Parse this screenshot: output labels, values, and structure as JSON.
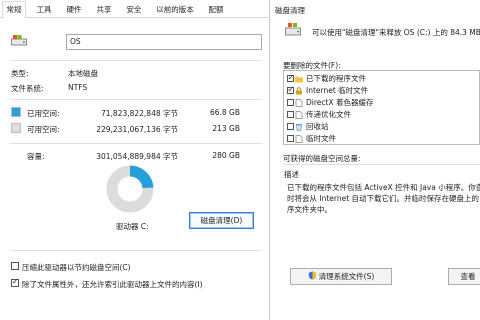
{
  "left": {
    "tabs": [
      "常规",
      "工具",
      "硬件",
      "共享",
      "安全",
      "以前的版本",
      "配额"
    ],
    "volume_name": "OS",
    "type_label": "类型:",
    "type_value": "本地磁盘",
    "fs_label": "文件系统:",
    "fs_value": "NTFS",
    "used_label": "已用空间:",
    "used_bytes": "71,823,822,848 字节",
    "used_gb": "66.8 GB",
    "free_label": "可用空间:",
    "free_bytes": "229,231,067,136 字节",
    "free_gb": "213 GB",
    "capacity_label": "容量:",
    "capacity_bytes": "301,054,889,984 字节",
    "capacity_gb": "280 GB",
    "drive_label": "驱动器 C:",
    "cleanup_button": "磁盘清理(D)",
    "compress_label": "压缩此驱动器以节约磁盘空间(C)",
    "index_label": "除了文件属性外，还允许索引此驱动器上文件的内容(I)",
    "compress_checked": false,
    "index_checked": true,
    "used_fraction": 0.239,
    "colors": {
      "used": "#26a0da",
      "free": "#dcdcdc"
    }
  },
  "right": {
    "title": "磁盘清理",
    "intro": "可以使用\"磁盘清理\"来释放 OS (C:) 上的 84.3 MB 磁",
    "files_label": "要删除的文件(F):",
    "items": [
      {
        "label": "已下载的程序文件",
        "checked": true,
        "icon": "folder-icon"
      },
      {
        "label": "Internet 临时文件",
        "checked": true,
        "icon": "lock-icon"
      },
      {
        "label": "DirectX 着色器缓存",
        "checked": false,
        "icon": "file-icon"
      },
      {
        "label": "传递优化文件",
        "checked": false,
        "icon": "file-icon"
      },
      {
        "label": "回收站",
        "checked": false,
        "icon": "recycle-bin-icon"
      },
      {
        "label": "临时文件",
        "checked": false,
        "icon": "file-icon"
      }
    ],
    "total_label": "可获得的磁盘空间总量:",
    "desc_title": "描述",
    "desc_lines": [
      "已下载的程序文件包括 ActiveX 控件和 Java 小程序。你查",
      "时将会从 Internet 自动下载它们。并临时保存在硬盘上的",
      "序文件夹中。"
    ],
    "cleanup_system_button": "清理系统文件(S)",
    "view_button": "查看"
  }
}
